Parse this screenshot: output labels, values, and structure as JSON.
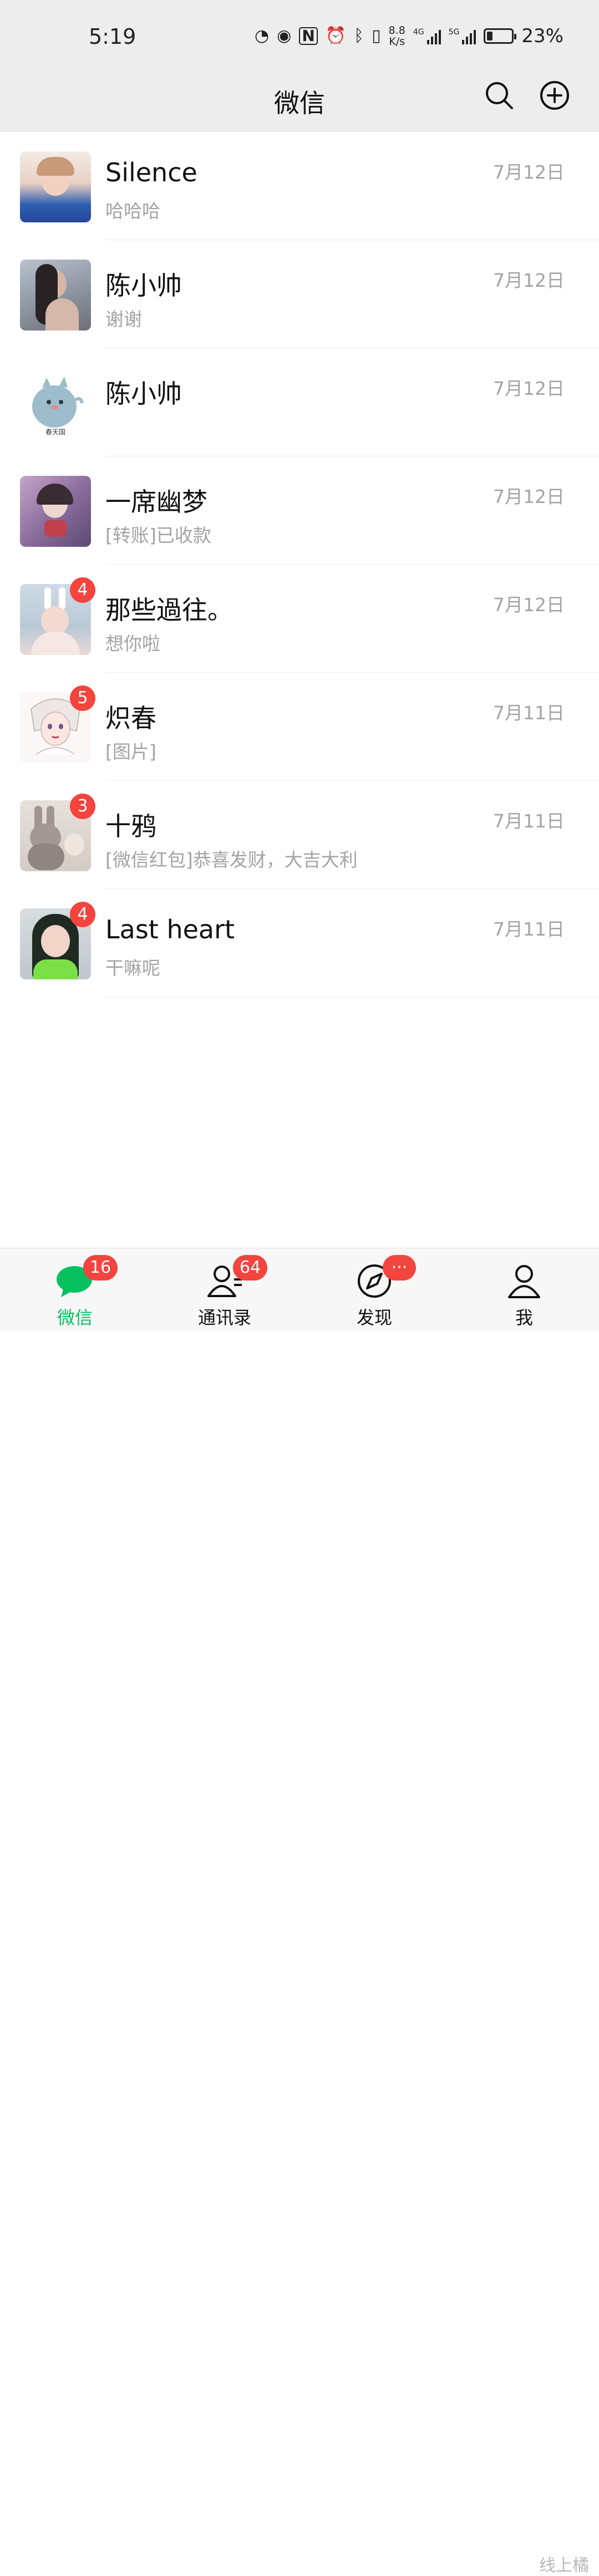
{
  "status_bar": {
    "time": "5:19",
    "net_speed_value": "8.8",
    "net_speed_unit": "K/s",
    "sim1_label": "4G",
    "sim2_label": "5G",
    "battery_percent": "23%",
    "battery_level": 0.23
  },
  "header": {
    "title": "微信",
    "search_icon": "search-icon",
    "add_icon": "plus-circle-icon"
  },
  "chats": [
    {
      "name": "Silence",
      "preview": "哈哈哈",
      "time": "7月12日",
      "badge": ""
    },
    {
      "name": "陈小帅",
      "preview": "谢谢",
      "time": "7月12日",
      "badge": ""
    },
    {
      "name": "陈小帅",
      "preview": "",
      "time": "7月12日",
      "badge": "",
      "avatar_caption": "春天国"
    },
    {
      "name": "一席幽梦",
      "preview": "[转账]已收款",
      "time": "7月12日",
      "badge": ""
    },
    {
      "name": "那些過往。",
      "preview": "想你啦",
      "time": "7月12日",
      "badge": "4"
    },
    {
      "name": "炽春",
      "preview": "[图片]",
      "time": "7月11日",
      "badge": "5"
    },
    {
      "name": "十鸦",
      "preview": "[微信红包]恭喜发财，大吉大利",
      "time": "7月11日",
      "badge": "3"
    },
    {
      "name": "Last heart",
      "preview": "干嘛呢",
      "time": "7月11日",
      "badge": "4"
    }
  ],
  "tabs": [
    {
      "label": "微信",
      "badge": "16",
      "icon": "chat-bubble-icon",
      "active": true
    },
    {
      "label": "通讯录",
      "badge": "64",
      "icon": "contacts-icon",
      "active": false
    },
    {
      "label": "发现",
      "badge": "···",
      "icon": "compass-icon",
      "active": false
    },
    {
      "label": "我",
      "badge": "",
      "icon": "person-icon",
      "active": false
    }
  ],
  "watermark": "线上橘",
  "colors": {
    "accent_green": "#07c160",
    "badge_red": "#f3443e",
    "header_bg": "#ededed",
    "secondary_text": "#a3a3a3"
  }
}
